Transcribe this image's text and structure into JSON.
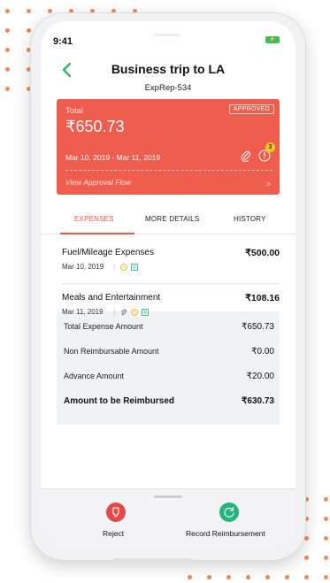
{
  "status_bar": {
    "time": "9:41"
  },
  "header": {
    "title": "Business trip to LA",
    "report_id": "ExpRep-534"
  },
  "summary_card": {
    "total_label": "Total",
    "status_badge": "APPROVED",
    "total_amount": "₹650.73",
    "date_range": "Mar 10, 2019 - Mar 11, 2019",
    "policy_violation_count": "3",
    "approval_link": "View Approval Flow",
    "color": "#ee5d4e"
  },
  "tabs": [
    {
      "label": "EXPENSES",
      "active": true
    },
    {
      "label": "MORE DETAILS",
      "active": false
    },
    {
      "label": "HISTORY",
      "active": false
    }
  ],
  "expenses": [
    {
      "title": "Fuel/Mileage Expenses",
      "amount": "₹500.00",
      "date": "Mar 10, 2019",
      "icons": [
        "info-icon",
        "receipt-icon"
      ]
    },
    {
      "title": "Meals and Entertainment",
      "amount": "₹108.16",
      "date": "Mar 11, 2019",
      "icons": [
        "attachment-icon",
        "info-icon",
        "receipt-icon"
      ]
    }
  ],
  "totals": [
    {
      "label": "Total Expense Amount",
      "value": "₹650.73"
    },
    {
      "label": "Non Reimbursable Amount",
      "value": "₹0.00"
    },
    {
      "label": "Advance Amount",
      "value": "₹20.00"
    },
    {
      "label": "Amount to be Reimbursed",
      "value": "₹630.73"
    }
  ],
  "actions": {
    "reject_label": "Reject",
    "reimburse_label": "Record Reimbursement",
    "reject_color": "#e54848",
    "reimburse_color": "#24b47e"
  },
  "accent_color": "#e85a4a"
}
